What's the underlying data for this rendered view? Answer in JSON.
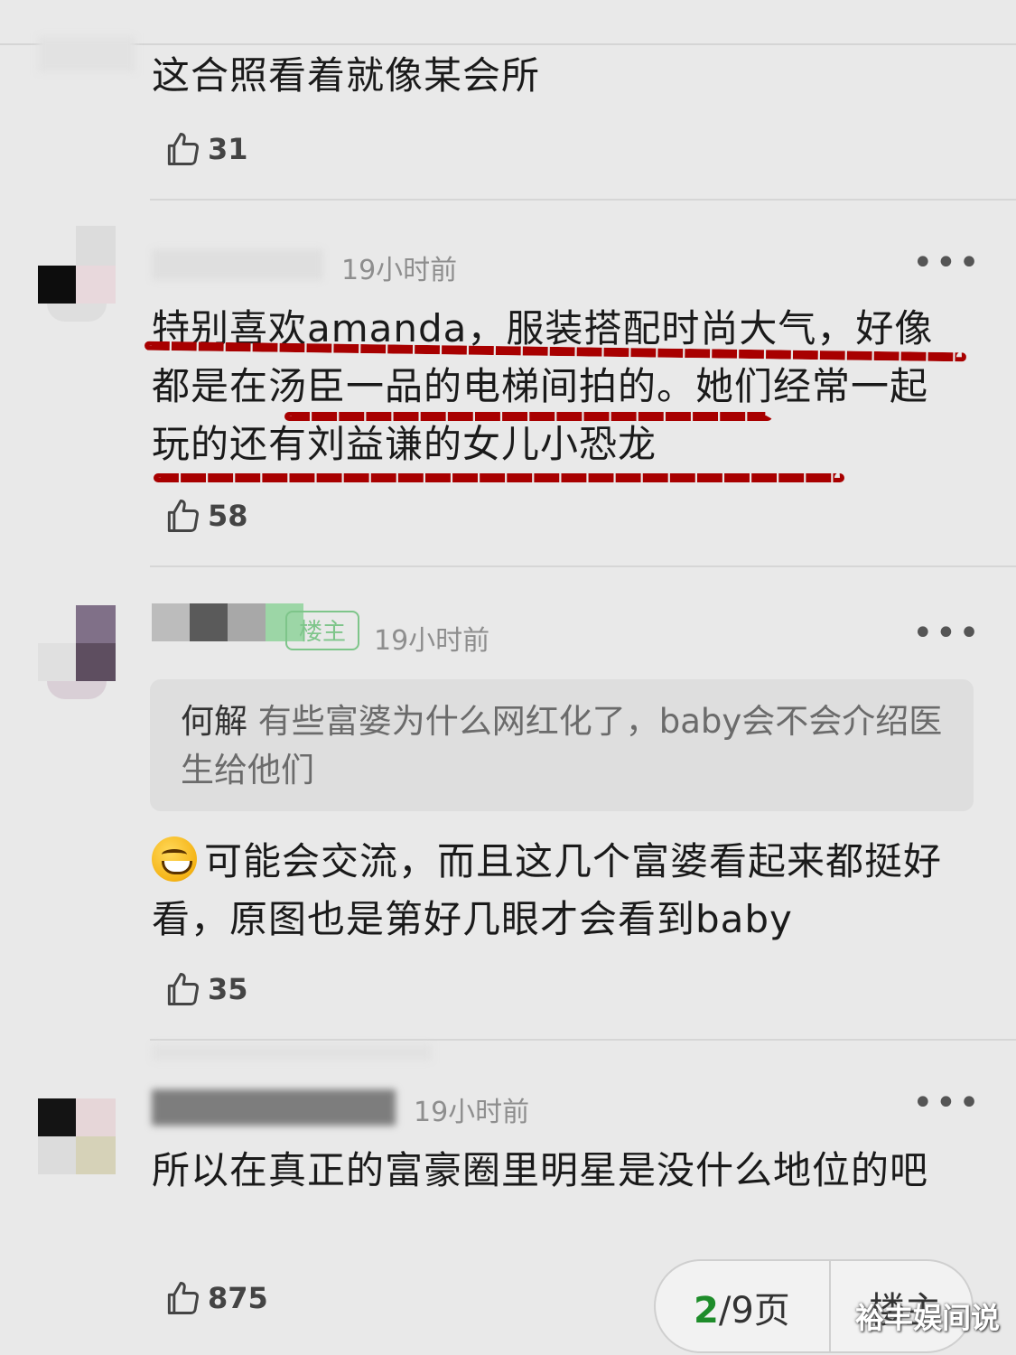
{
  "comments": [
    {
      "text": "这合照看着就像某会所",
      "likes": "31"
    },
    {
      "time": "19小时前",
      "text": "特别喜欢amanda，服装搭配时尚大气，好像都是在汤臣一品的电梯间拍的。她们经常一起玩的还有刘益谦的女儿小恐龙",
      "likes": "58"
    },
    {
      "badge": "楼主",
      "time": "19小时前",
      "quote_author": "何解",
      "quote_text": "有些富婆为什么网红化了，baby会不会介绍医生给他们",
      "text": "可能会交流，而且这几个富婆看起来都挺好看，原图也是第好几眼才会看到baby",
      "emoji": "grinning-face-emoji",
      "likes": "35"
    },
    {
      "time": "19小时前",
      "text": "所以在真正的富豪圈里明星是没什么地位的吧",
      "likes": "875"
    }
  ],
  "more_label": "•••",
  "pager": {
    "current": "2",
    "total": "/9",
    "unit": "页",
    "louzhu": "楼主"
  },
  "watermark": "裕丰娱间说",
  "colors": {
    "background": "#e9e9e9",
    "annotation_dash": "#a80000",
    "pager_current": "#1e8c2a"
  },
  "icons": [
    "thumbs-up-icon",
    "more-icon"
  ]
}
